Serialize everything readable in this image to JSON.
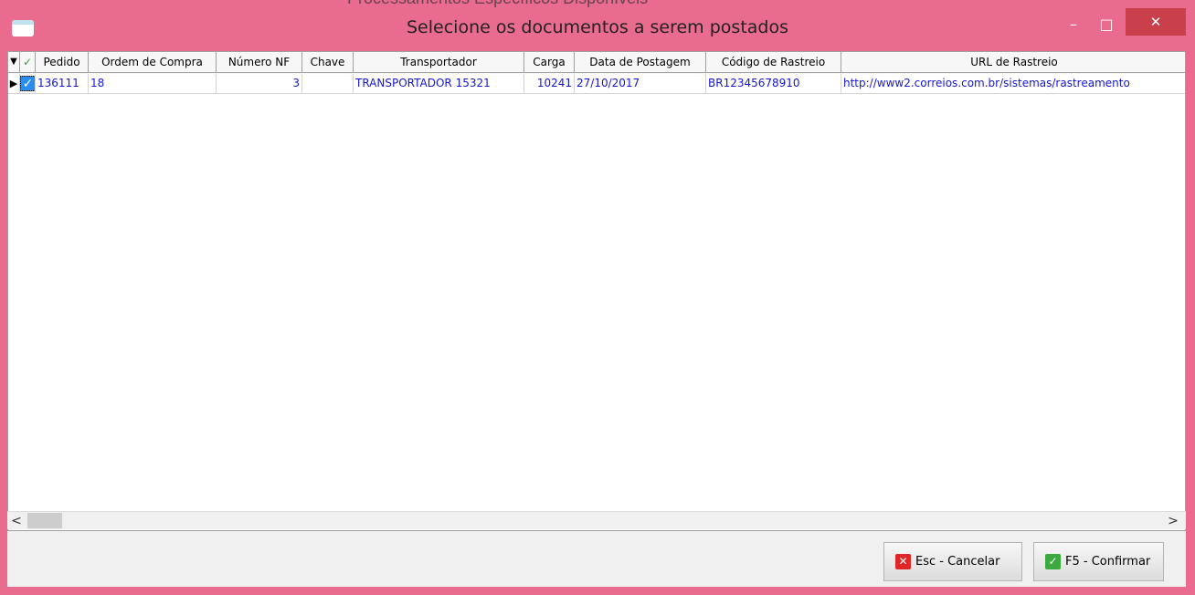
{
  "window": {
    "title": "Selecione os documentos a serem postados",
    "behind_text": "Processamentos Específicos Disponíveis",
    "minimize_glyph": "–",
    "maximize_glyph": "□",
    "close_glyph": "✕"
  },
  "grid": {
    "filter_glyph": "▼",
    "check_glyph": "✓",
    "columns": [
      "Pedido",
      "Ordem de Compra",
      "Número NF",
      "Chave",
      "Transportador",
      "Carga",
      "Data de Postagem",
      "Código de Rastreio",
      "URL de Rastreio"
    ],
    "rows": [
      {
        "indicator": "▶",
        "checked_glyph": "✓",
        "pedido": "136111",
        "ordem_compra": "18",
        "numero_nf": "3",
        "chave": "",
        "transportador": "TRANSPORTADOR 15321",
        "carga": "10241",
        "data_postagem": "27/10/2017",
        "codigo_rastreio": "BR12345678910",
        "url_rastreio": "http://www2.correios.com.br/sistemas/rastreamento"
      }
    ]
  },
  "scroll": {
    "left": "<",
    "right": ">"
  },
  "buttons": {
    "cancel_label": "Esc - Cancelar",
    "cancel_icon": "✕",
    "confirm_label": "F5 - Confirmar",
    "confirm_icon": "✓"
  },
  "colors": {
    "frame": "#e96b8d",
    "close": "#c9404c",
    "row_text": "#1515d8",
    "check": "#2a8ef0"
  }
}
